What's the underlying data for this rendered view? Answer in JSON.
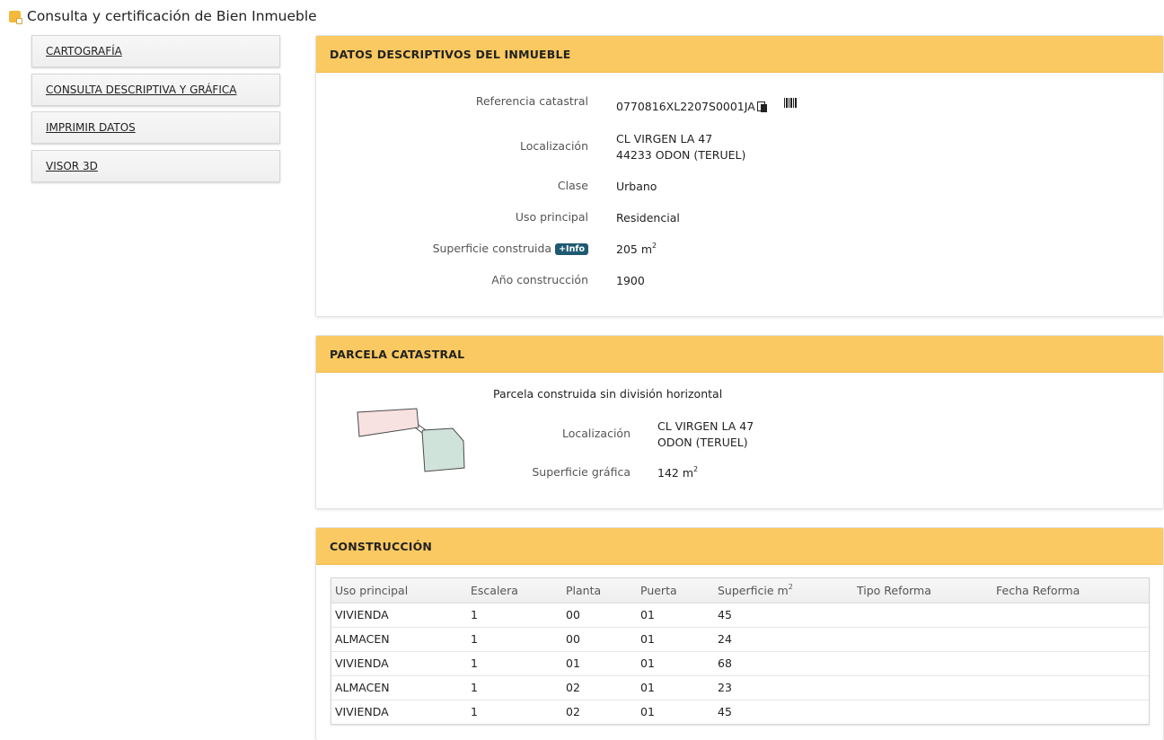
{
  "page": {
    "title": "Consulta y certificación de Bien Inmueble"
  },
  "colors": {
    "accent_header": "#fbc961",
    "info_badge": "#1f5a73",
    "parcel_fill_1": "#f7e1e1",
    "parcel_fill_2": "#cfe3da"
  },
  "sidebar": {
    "items": [
      {
        "label": "CARTOGRAFÍA"
      },
      {
        "label": "CONSULTA DESCRIPTIVA Y GRÁFICA"
      },
      {
        "label": "IMPRIMIR DATOS"
      },
      {
        "label": "VISOR 3D"
      }
    ]
  },
  "datos": {
    "title": "DATOS DESCRIPTIVOS DEL INMUEBLE",
    "ref_label": "Referencia catastral",
    "ref_value": "0770816XL2207S0001JA",
    "loc_label": "Localización",
    "loc_line1": "CL VIRGEN LA 47",
    "loc_line2": "44233 ODON (TERUEL)",
    "clase_label": "Clase",
    "clase_value": "Urbano",
    "uso_label": "Uso principal",
    "uso_value": "Residencial",
    "sup_label": "Superficie construida",
    "info_badge": "+Info",
    "sup_value": "205 m",
    "sup_unit_exp": "2",
    "anio_label": "Año construcción",
    "anio_value": "1900"
  },
  "parcela": {
    "title": "PARCELA CATASTRAL",
    "tipo": "Parcela construida sin división horizontal",
    "loc_label": "Localización",
    "loc_line1": "CL VIRGEN LA 47",
    "loc_line2": "ODON (TERUEL)",
    "sup_label": "Superficie gráfica",
    "sup_value": "142 m",
    "sup_unit_exp": "2"
  },
  "construccion": {
    "title": "CONSTRUCCIÓN",
    "columns": [
      "Uso principal",
      "Escalera",
      "Planta",
      "Puerta",
      "Superficie m",
      "Tipo Reforma",
      "Fecha Reforma"
    ],
    "superficie_exp": "2",
    "rows": [
      [
        "VIVIENDA",
        "1",
        "00",
        "01",
        "45",
        "",
        ""
      ],
      [
        "ALMACEN",
        "1",
        "00",
        "01",
        "24",
        "",
        ""
      ],
      [
        "VIVIENDA",
        "1",
        "01",
        "01",
        "68",
        "",
        ""
      ],
      [
        "ALMACEN",
        "1",
        "02",
        "01",
        "23",
        "",
        ""
      ],
      [
        "VIVIENDA",
        "1",
        "02",
        "01",
        "45",
        "",
        ""
      ]
    ]
  }
}
